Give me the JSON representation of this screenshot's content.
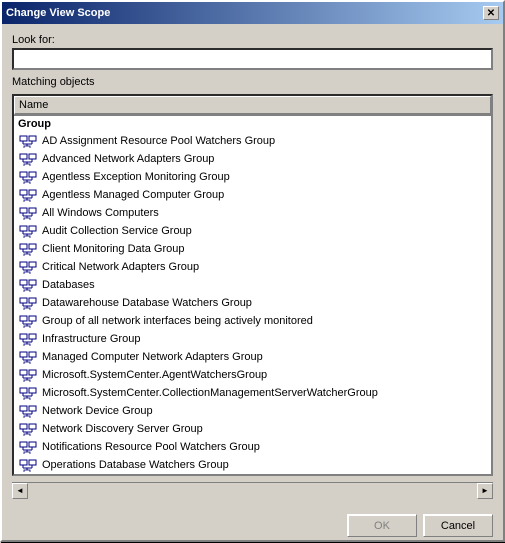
{
  "window": {
    "title": "Change View Scope",
    "close_label": "✕"
  },
  "look_for": {
    "label": "Look for:",
    "placeholder": "",
    "value": ""
  },
  "matching_objects": {
    "label": "Matching objects",
    "column_header": "Name",
    "group_label": "Group",
    "items": [
      {
        "text": "AD Assignment Resource Pool Watchers Group"
      },
      {
        "text": "Advanced Network Adapters Group"
      },
      {
        "text": "Agentless Exception Monitoring Group"
      },
      {
        "text": "Agentless Managed Computer Group"
      },
      {
        "text": "All Windows Computers"
      },
      {
        "text": "Audit Collection Service Group"
      },
      {
        "text": "Client Monitoring Data Group"
      },
      {
        "text": "Critical Network Adapters Group"
      },
      {
        "text": "Databases"
      },
      {
        "text": "Datawarehouse Database Watchers Group"
      },
      {
        "text": "Group of all network interfaces being actively monitored"
      },
      {
        "text": "Infrastructure Group"
      },
      {
        "text": "Managed Computer Network Adapters Group"
      },
      {
        "text": "Microsoft.SystemCenter.AgentWatchersGroup"
      },
      {
        "text": "Microsoft.SystemCenter.CollectionManagementServerWatcherGroup"
      },
      {
        "text": "Network Device Group"
      },
      {
        "text": "Network Discovery Server Group"
      },
      {
        "text": "Notifications Resource Pool Watchers Group"
      },
      {
        "text": "Operations Database Watchers Group"
      }
    ]
  },
  "buttons": {
    "ok_label": "OK",
    "cancel_label": "Cancel"
  }
}
